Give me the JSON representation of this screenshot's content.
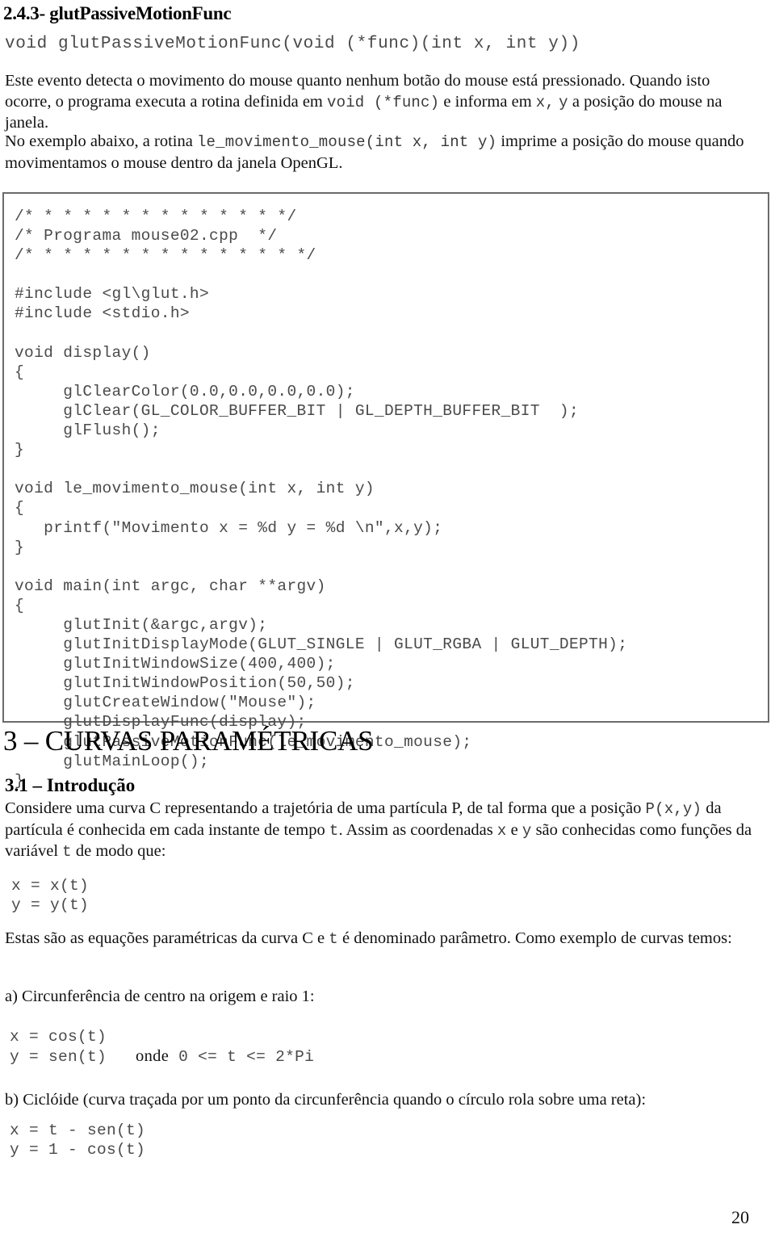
{
  "document": {
    "page_number": "20"
  },
  "section_243": {
    "heading": "2.4.3- glutPassiveMotionFunc",
    "signature": "void glutPassiveMotionFunc(void (*func)(int x, int y))",
    "paragraph_1": {
      "part_1": "Este evento detecta o movimento do mouse quanto nenhum botão do mouse está pressionado. Quando isto ocorre, o programa executa a rotina definida em ",
      "code_1": "void (*func)",
      "part_2": " e informa em ",
      "code_2": "x,",
      "part_3": " ",
      "code_3": "y",
      "part_4": " a posição do mouse na janela."
    },
    "paragraph_2": {
      "part_1": "No exemplo abaixo, a rotina ",
      "code_1": "le_movimento_mouse(int x, int y)",
      "part_2": " imprime a posição do mouse quando movimentamos o mouse dentro da janela OpenGL."
    },
    "code_listing": "/* * * * * * * * * * * * * */\n/* Programa mouse02.cpp  */\n/* * * * * * * * * * * * * * */\n\n#include <gl\\glut.h>\n#include <stdio.h>\n\nvoid display()\n{\n     glClearColor(0.0,0.0,0.0,0.0);\n     glClear(GL_COLOR_BUFFER_BIT | GL_DEPTH_BUFFER_BIT  );\n     glFlush();\n}\n\nvoid le_movimento_mouse(int x, int y)\n{\n   printf(\"Movimento x = %d y = %d \\n\",x,y);\n}\n\nvoid main(int argc, char **argv)\n{\n     glutInit(&argc,argv);\n     glutInitDisplayMode(GLUT_SINGLE | GLUT_RGBA | GLUT_DEPTH);\n     glutInitWindowSize(400,400);\n     glutInitWindowPosition(50,50);\n     glutCreateWindow(\"Mouse\");\n     glutDisplayFunc(display);\n     glutPassiveMotionFunc(le_movimento_mouse);\n     glutMainLoop();\n}"
  },
  "section_3": {
    "heading": "3 – CURVAS PARAMÉTRICAS",
    "subsection_31": {
      "heading": "3.1 – Introdução",
      "paragraph_1": {
        "part_1": "Considere uma curva C representando a trajetória de uma partícula P, de tal forma que a posição ",
        "code_1": "P(x,y)",
        "part_2": " da partícula é conhecida em cada instante de tempo ",
        "code_2": "t",
        "part_3": ". Assim as coordenadas ",
        "code_3": "x",
        "part_4": " e ",
        "code_4": "y",
        "part_5": " são conhecidas como funções da variável ",
        "code_5": "t",
        "part_6": " de modo que:"
      },
      "equations_general": "x = x(t)\ny = y(t)",
      "paragraph_2": {
        "part_1": "Estas são as equações paramétricas da curva C e ",
        "code_1": "t",
        "part_2": " é denominado parâmetro. Como exemplo de curvas temos:"
      },
      "example_a": {
        "label": "a) Circunferência de centro na origem e raio 1:",
        "equation_x": "x = cos(t)",
        "equation_y": "y = sen(t)",
        "condition_word": "onde",
        "condition_range": "0 <= t <= 2*Pi"
      },
      "example_b": {
        "label": "b) Ciclóide (curva traçada por um ponto da circunferência quando o círculo rola sobre uma reta):",
        "equations": "x = t - sen(t)\ny = 1 - cos(t)"
      }
    }
  }
}
